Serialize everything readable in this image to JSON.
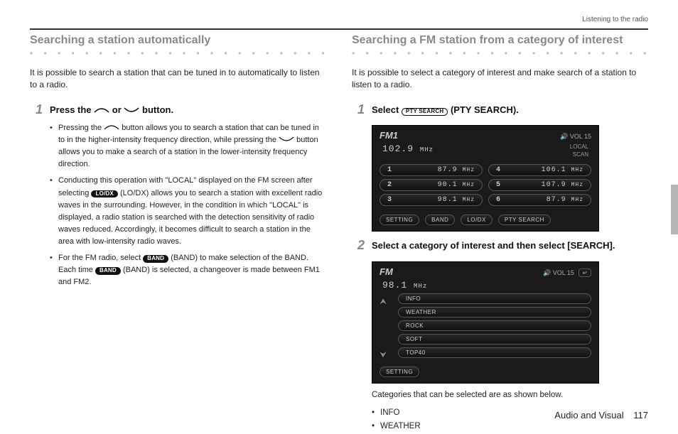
{
  "header": {
    "crumb": "Listening to the radio"
  },
  "left": {
    "title": "Searching a station automatically",
    "intro": "It is possible to search a station that can be tuned in to automatically to listen to a radio.",
    "step1": {
      "num": "1",
      "head_a": "Press the ",
      "head_b": " or ",
      "head_c": " button.",
      "b1a": "Pressing the ",
      "b1b": " button allows you to search a station that can be tuned in to in the higher-intensity frequency direction, while pressing the ",
      "b1c": " button allows you to make a search of a station in the lower-intensity frequency direction.",
      "b2a": "Conducting this operation with \"LOCAL\" displayed on the FM screen after selecting ",
      "lodx": "LO/DX",
      "b2b": " (LO/DX) allows you to search a station with excellent radio waves in the surrounding. However, in the condition in which \"LOCAL\" is displayed, a radio station is searched with the detection sensitivity of radio waves reduced. Accordingly, it becomes difficult to search a station in the area with low-intensity radio waves.",
      "b3a": "For the FM radio, select ",
      "band": "BAND",
      "b3b": " (BAND) to make selection of the BAND. Each time ",
      "b3c": " (BAND) is selected, a changeover is made between FM1 and FM2."
    }
  },
  "right": {
    "title": "Searching a FM station from a category of interest",
    "intro": "It is possible to select a category of interest and make search of a station to listen to a radio.",
    "step1": {
      "num": "1",
      "head_a": "Select ",
      "pty": "PTY SEARCH",
      "head_b": " (PTY SEARCH)."
    },
    "shot1": {
      "band": "FM1",
      "vol": "VOL 15",
      "freq": "102.9",
      "freq_unit": "MHz",
      "side1": "LOCAL",
      "side2": "SCAN",
      "presets": [
        {
          "n": "1",
          "f": "87.9",
          "u": "MHz"
        },
        {
          "n": "4",
          "f": "106.1",
          "u": "MHz"
        },
        {
          "n": "2",
          "f": "90.1",
          "u": "MHz"
        },
        {
          "n": "5",
          "f": "107.9",
          "u": "MHz"
        },
        {
          "n": "3",
          "f": "98.1",
          "u": "MHz"
        },
        {
          "n": "6",
          "f": "87.9",
          "u": "MHz"
        }
      ],
      "foot": [
        "SETTING",
        "BAND",
        "LO/DX",
        "PTY SEARCH"
      ]
    },
    "step2": {
      "num": "2",
      "head": "Select a category of interest and then select [SEARCH]."
    },
    "shot2": {
      "band": "FM",
      "vol": "VOL 15",
      "freq": "98.1",
      "freq_unit": "MHz",
      "cats": [
        "INFO",
        "WEATHER",
        "ROCK",
        "SOFT",
        "TOP40"
      ],
      "foot": [
        "SETTING"
      ],
      "back": "⬆"
    },
    "note": "Categories that can be selected are as shown below.",
    "catlist": [
      "INFO",
      "WEATHER"
    ]
  },
  "footer": {
    "section": "Audio and Visual",
    "page": "117"
  }
}
